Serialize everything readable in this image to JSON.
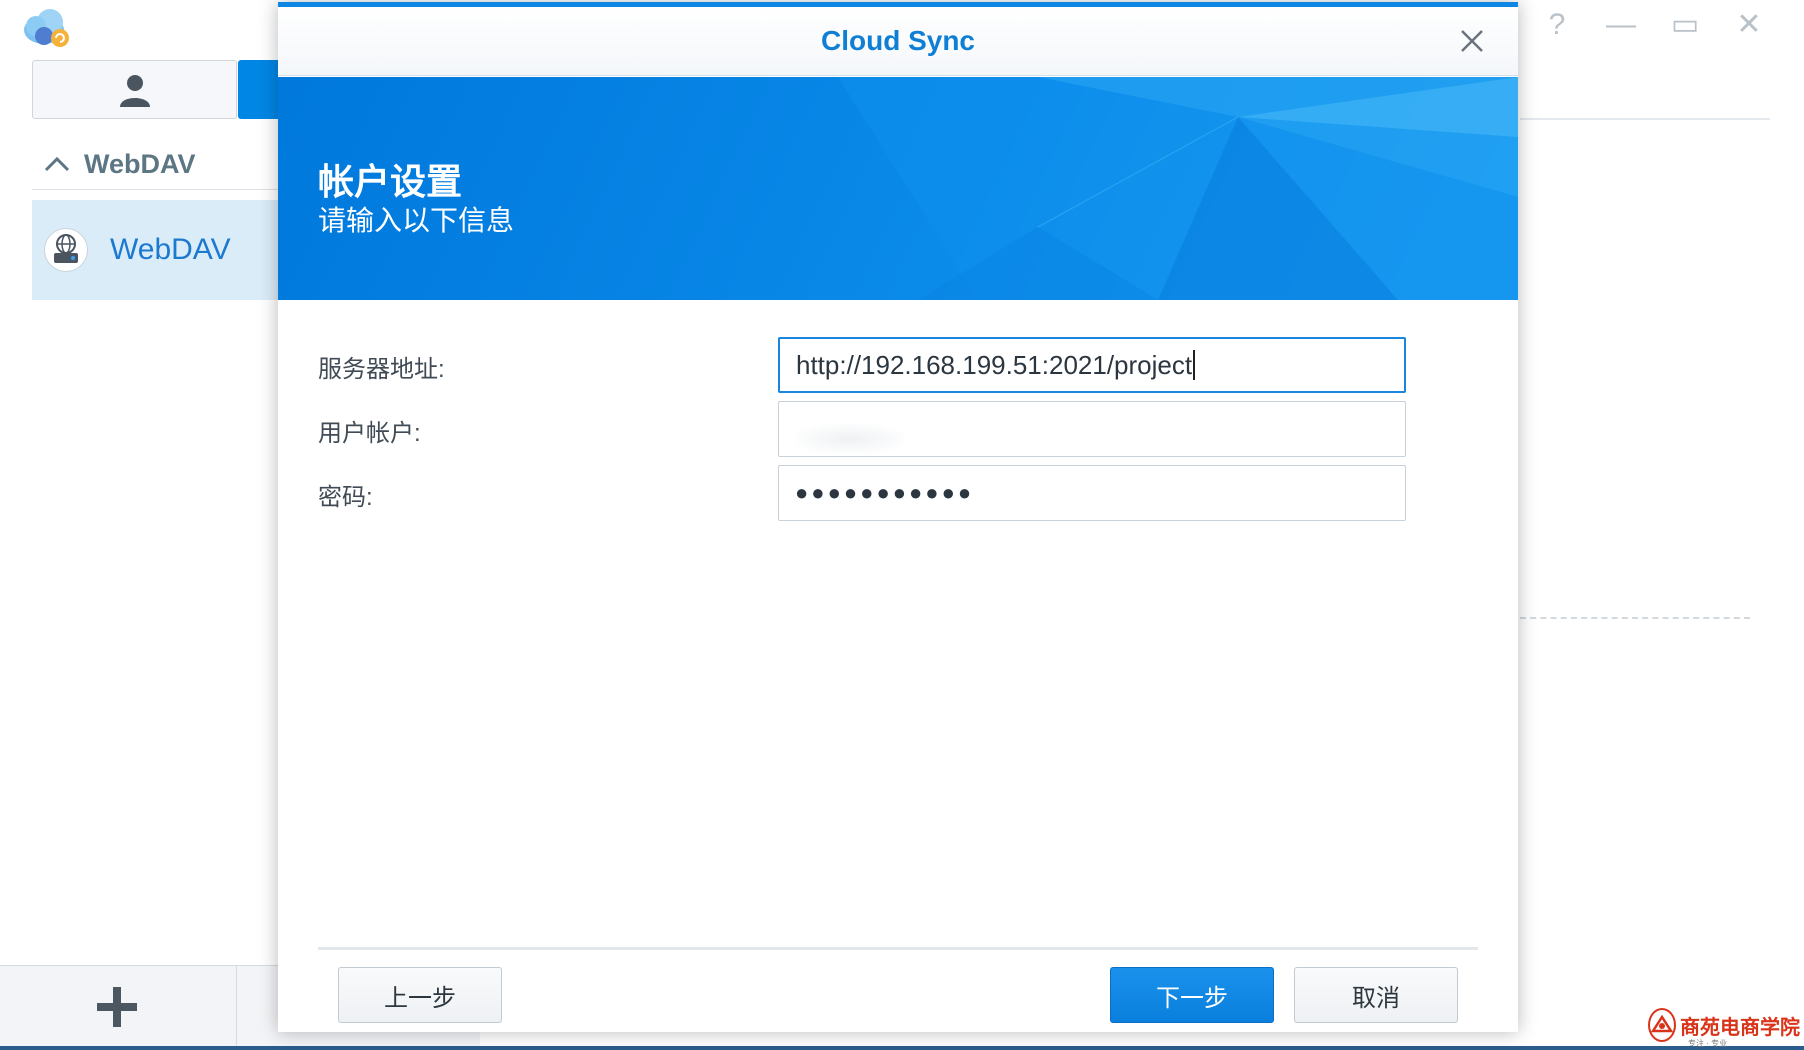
{
  "app": {
    "window_controls": {
      "help": "?",
      "minimize": "—",
      "maximize": "▭",
      "close": "✕"
    },
    "sidebar": {
      "group_title": "WebDAV",
      "items": [
        {
          "label": "WebDAV",
          "icon": "webdav-globe-icon"
        }
      ]
    },
    "add_button_icon": "plus-icon"
  },
  "dialog": {
    "title": "Cloud Sync",
    "banner": {
      "title": "帐户设置",
      "subtitle": "请输入以下信息"
    },
    "fields": {
      "server": {
        "label": "服务器地址:",
        "value": "http://192.168.199.51:2021/project"
      },
      "account": {
        "label": "用户帐户:",
        "value": ""
      },
      "password": {
        "label": "密码:",
        "value": "●●●●●●●●●●●"
      }
    },
    "buttons": {
      "back": "上一步",
      "next": "下一步",
      "cancel": "取消"
    }
  },
  "watermark": {
    "text": "商苑电商学院",
    "sub": "专注 · 专业"
  },
  "colors": {
    "accent": "#0e86e3",
    "primary_button": "#0a7fdd",
    "selected_item": "#dbecf9"
  }
}
